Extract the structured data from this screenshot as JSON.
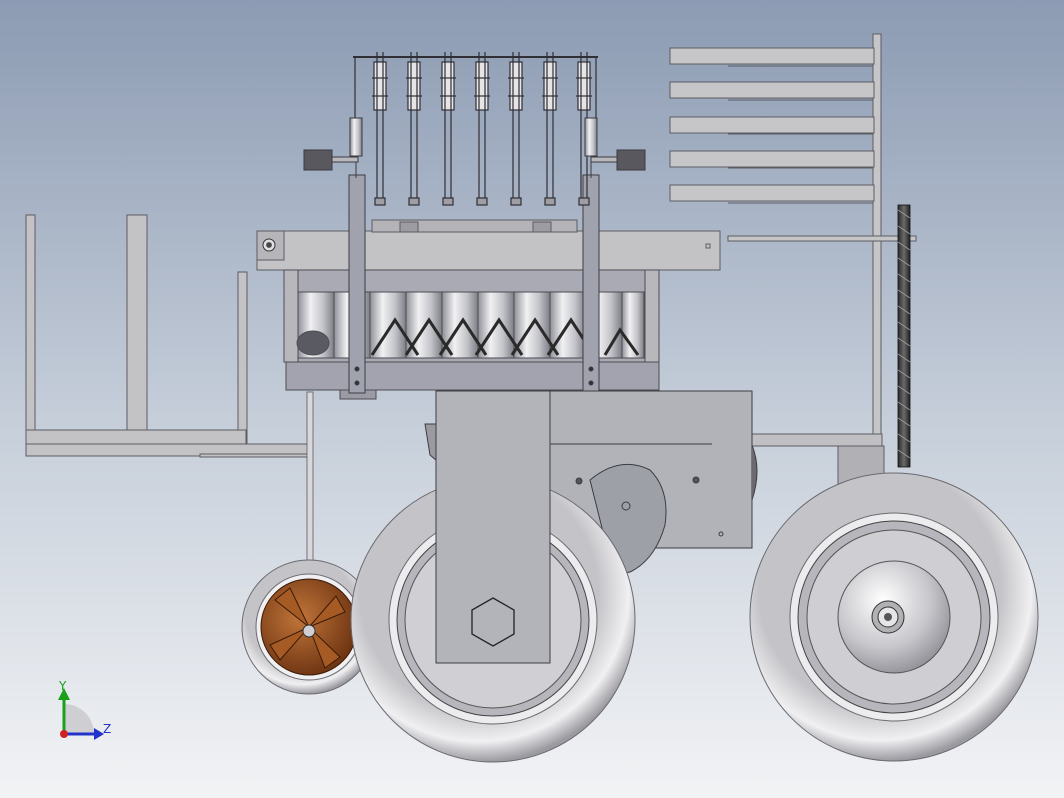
{
  "view": {
    "background_top": "#8c9bb3",
    "background_bottom": "#f2f3f5"
  },
  "triad": {
    "y_label": "Y",
    "z_label": "Z",
    "y_color": "#1aa01a",
    "z_color": "#2233cc",
    "x_dot_color": "#d02020"
  },
  "model": {
    "frame_color": "#b9b9bd",
    "steel_color": "#a7a9b3",
    "tire_color": "#d8d8dc",
    "rim_color": "#9c9ca4",
    "bronze_color": "#8a4a1c",
    "dark_color": "#4a4a4a",
    "coupler_count": 7,
    "shelf_count": 5
  }
}
